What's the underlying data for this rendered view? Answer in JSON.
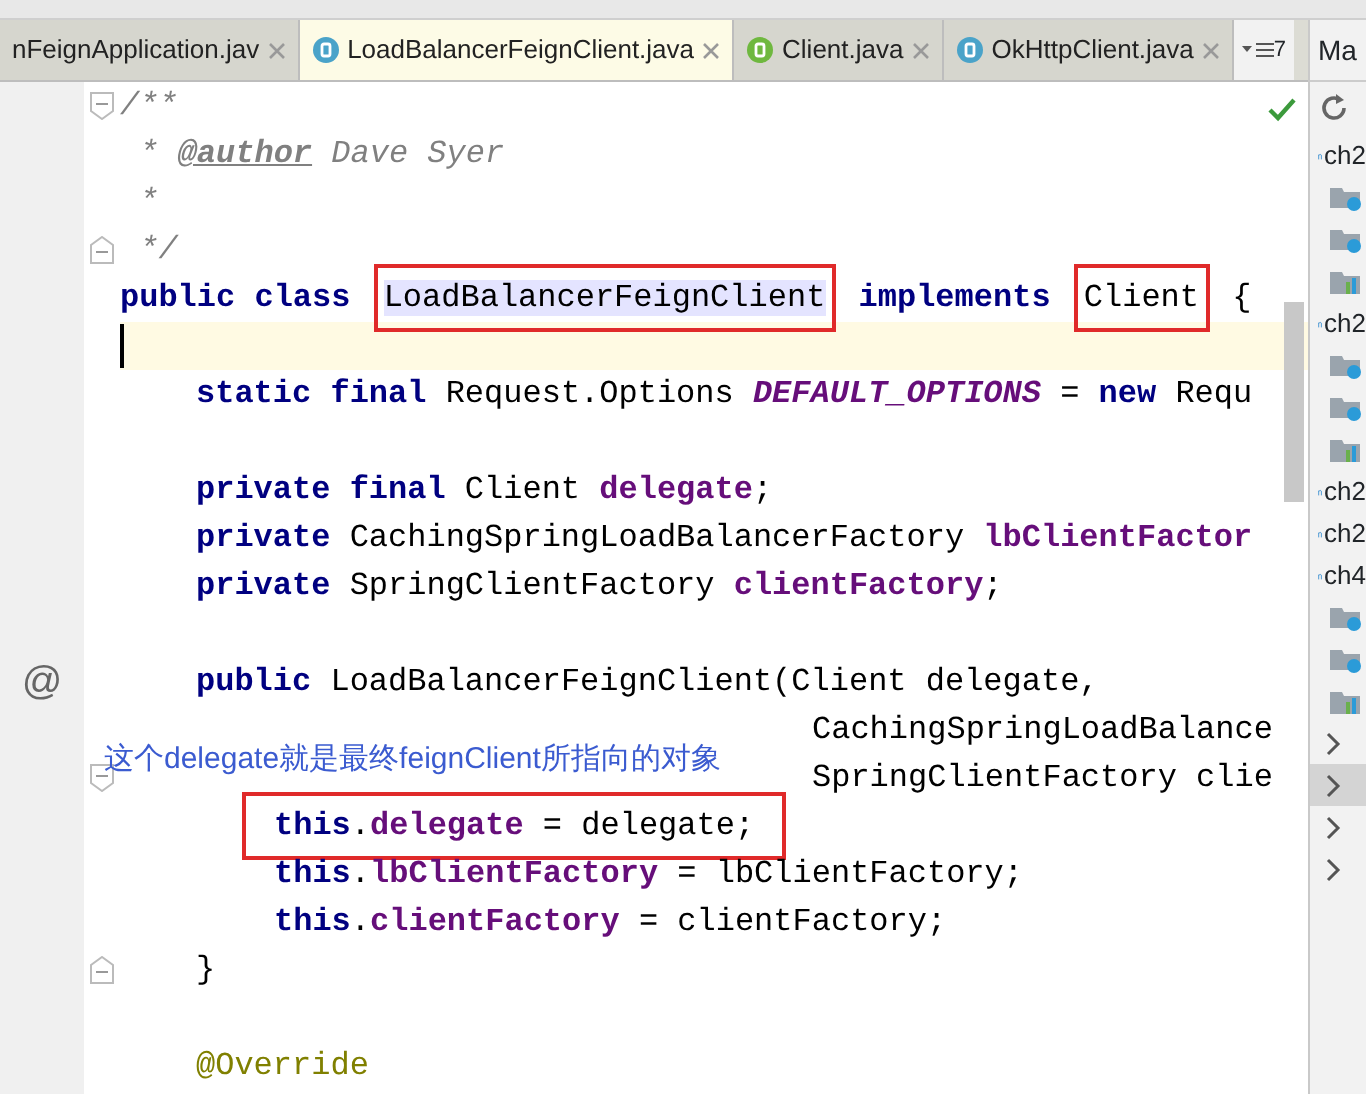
{
  "tabs": [
    {
      "label": "nFeignApplication.jav",
      "kind": "plain",
      "selected": false
    },
    {
      "label": "LoadBalancerFeignClient.java",
      "kind": "class",
      "selected": true
    },
    {
      "label": "Client.java",
      "kind": "interface",
      "selected": false
    },
    {
      "label": "OkHttpClient.java",
      "kind": "class",
      "selected": false
    }
  ],
  "tab_overflow": {
    "count": "7"
  },
  "editor": {
    "lines": [
      {
        "kind": "top",
        "fold_start": true,
        "segments": [
          {
            "tokens": [
              {
                "kind": "comment",
                "text": "/**"
              }
            ]
          }
        ]
      },
      {
        "kind": "top",
        "segments": [
          {
            "tokens": [
              {
                "kind": "comment",
                "text": " * "
              },
              {
                "kind": "doctag",
                "text": "@author"
              },
              {
                "kind": "comment",
                "text": " Dave Syer"
              }
            ]
          }
        ]
      },
      {
        "kind": "top",
        "segments": [
          {
            "tokens": [
              {
                "kind": "comment",
                "text": " *"
              }
            ]
          }
        ]
      },
      {
        "kind": "top",
        "fold_end": true,
        "segments": [
          {
            "tokens": [
              {
                "kind": "comment",
                "text": " */"
              }
            ]
          }
        ]
      },
      {
        "kind": "top",
        "segments": [
          {
            "tokens": [
              {
                "kind": "keyword",
                "text": "public class "
              }
            ]
          },
          {
            "box": true,
            "tokens": [
              {
                "kind": "plain",
                "text": "LoadBalancerFeignClient",
                "highlighted": true
              }
            ]
          },
          {
            "tokens": [
              {
                "kind": "keyword",
                "text": " implements "
              }
            ]
          },
          {
            "box": true,
            "tokens": [
              {
                "kind": "plain",
                "text": "Client"
              }
            ]
          },
          {
            "tokens": [
              {
                "kind": "plain",
                "text": " {"
              }
            ]
          }
        ]
      },
      {
        "kind": "top",
        "current": true
      },
      {
        "kind": "member",
        "segments": [
          {
            "tokens": [
              {
                "kind": "keyword",
                "text": "static final "
              },
              {
                "kind": "plain",
                "text": "Request.Options "
              },
              {
                "kind": "constant",
                "text": "DEFAULT_OPTIONS"
              },
              {
                "kind": "plain",
                "text": " = "
              },
              {
                "kind": "keyword",
                "text": "new "
              },
              {
                "kind": "plain",
                "text": "Requ"
              }
            ]
          }
        ]
      },
      {
        "kind": "top"
      },
      {
        "kind": "member",
        "segments": [
          {
            "tokens": [
              {
                "kind": "keyword",
                "text": "private final "
              },
              {
                "kind": "plain",
                "text": "Client "
              },
              {
                "kind": "field",
                "text": "delegate"
              },
              {
                "kind": "plain",
                "text": ";"
              }
            ]
          }
        ]
      },
      {
        "kind": "member",
        "segments": [
          {
            "tokens": [
              {
                "kind": "keyword",
                "text": "private "
              },
              {
                "kind": "plain",
                "text": "CachingSpringLoadBalancerFactory "
              },
              {
                "kind": "field",
                "text": "lbClientFactor"
              }
            ]
          }
        ]
      },
      {
        "kind": "member",
        "segments": [
          {
            "tokens": [
              {
                "kind": "keyword",
                "text": "private "
              },
              {
                "kind": "plain",
                "text": "SpringClientFactory "
              },
              {
                "kind": "field",
                "text": "clientFactory"
              },
              {
                "kind": "plain",
                "text": ";"
              }
            ]
          }
        ]
      },
      {
        "kind": "top"
      },
      {
        "kind": "member",
        "gutter": "@",
        "segments": [
          {
            "tokens": [
              {
                "kind": "keyword",
                "text": "public "
              },
              {
                "kind": "plain",
                "text": "LoadBalancerFeignClient(Client delegate,"
              }
            ]
          }
        ]
      },
      {
        "kind": "continuation",
        "segments": [
          {
            "tokens": [
              {
                "kind": "plain",
                "text": "CachingSpringLoadBalance"
              }
            ]
          }
        ]
      },
      {
        "kind": "continuation",
        "fold_start": true,
        "note": "这个delegate就是最终feignClient所指向的对象",
        "segments": [
          {
            "tokens": [
              {
                "kind": "plain",
                "text": "SpringClientFactory clie"
              }
            ]
          }
        ]
      },
      {
        "kind": "body",
        "segments": [
          {
            "box": true,
            "tokens": [
              {
                "kind": "keyword",
                "text": "this"
              },
              {
                "kind": "plain",
                "text": "."
              },
              {
                "kind": "field",
                "text": "delegate"
              },
              {
                "kind": "plain",
                "text": " = delegate;"
              }
            ]
          }
        ]
      },
      {
        "kind": "body",
        "segments": [
          {
            "tokens": [
              {
                "kind": "keyword",
                "text": "this"
              },
              {
                "kind": "plain",
                "text": "."
              },
              {
                "kind": "field",
                "text": "lbClientFactory"
              },
              {
                "kind": "plain",
                "text": " = lbClientFactory;"
              }
            ]
          }
        ]
      },
      {
        "kind": "body",
        "segments": [
          {
            "tokens": [
              {
                "kind": "keyword",
                "text": "this"
              },
              {
                "kind": "plain",
                "text": "."
              },
              {
                "kind": "field",
                "text": "clientFactory"
              },
              {
                "kind": "plain",
                "text": " = clientFactory;"
              }
            ]
          }
        ]
      },
      {
        "kind": "member",
        "fold_end": true,
        "segments": [
          {
            "tokens": [
              {
                "kind": "plain",
                "text": "}"
              }
            ]
          }
        ]
      },
      {
        "kind": "top"
      },
      {
        "kind": "member",
        "segments": [
          {
            "tokens": [
              {
                "kind": "annotation",
                "text": "@Override"
              }
            ]
          }
        ]
      }
    ]
  },
  "side_panel": {
    "title": "Ma",
    "items": [
      {
        "kind": "module",
        "label": "ch2",
        "selected": false
      },
      {
        "kind": "folder",
        "selected": false
      },
      {
        "kind": "folder",
        "selected": false
      },
      {
        "kind": "lifecycle",
        "selected": false
      },
      {
        "kind": "module",
        "label": "ch2",
        "selected": false
      },
      {
        "kind": "folder",
        "selected": false
      },
      {
        "kind": "folder",
        "selected": false
      },
      {
        "kind": "lifecycle",
        "selected": false
      },
      {
        "kind": "module",
        "label": "ch2",
        "selected": false
      },
      {
        "kind": "module",
        "label": "ch2",
        "selected": false
      },
      {
        "kind": "module",
        "label": "ch4",
        "selected": false
      },
      {
        "kind": "folder",
        "selected": false
      },
      {
        "kind": "folder",
        "selected": false
      },
      {
        "kind": "lifecycle",
        "selected": false
      },
      {
        "kind": "collapsed",
        "selected": false
      },
      {
        "kind": "collapsed",
        "selected": true
      },
      {
        "kind": "collapsed",
        "selected": false
      },
      {
        "kind": "collapsed",
        "selected": false
      }
    ]
  }
}
